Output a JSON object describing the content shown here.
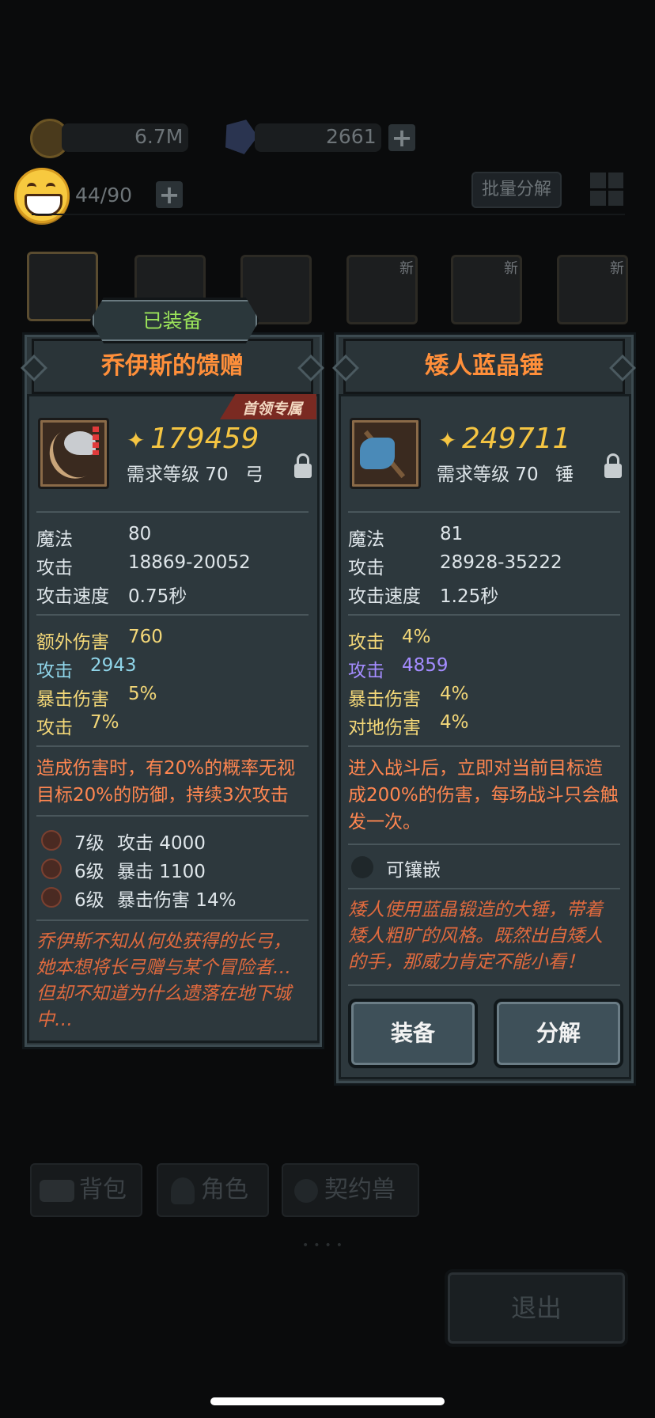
{
  "top": {
    "coins": "6.7M",
    "crystals": "2661",
    "bag_count": "44/90",
    "batch_label": "批量分解",
    "plus": "+"
  },
  "slots": [
    {
      "new": ""
    },
    {
      "new": ""
    },
    {
      "new": ""
    },
    {
      "new": "新"
    },
    {
      "new": "新"
    },
    {
      "new": "新"
    }
  ],
  "tabs": [
    "背包",
    "角色",
    "契约兽"
  ],
  "exit_label": "退出",
  "equipped_tag": "已装备",
  "left": {
    "title": "乔伊斯的馈赠",
    "badge": "首领专属",
    "power": "179459",
    "req": "需求等级 70",
    "type": "弓",
    "base": [
      {
        "label": "魔法",
        "value": "80"
      },
      {
        "label": "攻击",
        "value": "18869-20052"
      },
      {
        "label": "攻击速度",
        "value": "0.75秒"
      }
    ],
    "extra": [
      {
        "label": "额外伤害",
        "value": "760",
        "color": "#f3d778"
      },
      {
        "label": "攻击",
        "value": "2943",
        "color": "#8fd4e8"
      },
      {
        "label": "暴击伤害",
        "value": "5%",
        "color": "#f3d778"
      },
      {
        "label": "攻击",
        "value": "7%",
        "color": "#f3d778"
      }
    ],
    "skill": "造成伤害时，有20%的概率无视目标20%的防御，持续3次攻击",
    "gems": [
      {
        "level": "7级",
        "stat": "攻击 4000"
      },
      {
        "level": "6级",
        "stat": "暴击 1100"
      },
      {
        "level": "6级",
        "stat": "暴击伤害 14%"
      }
    ],
    "flavor": "乔伊斯不知从何处获得的长弓，她本想将长弓赠与某个冒险者…但却不知道为什么遗落在地下城中…"
  },
  "right": {
    "title": "矮人蓝晶锤",
    "power": "249711",
    "req": "需求等级 70",
    "type": "锤",
    "base": [
      {
        "label": "魔法",
        "value": "81"
      },
      {
        "label": "攻击",
        "value": "28928-35222"
      },
      {
        "label": "攻击速度",
        "value": "1.25秒"
      }
    ],
    "extra": [
      {
        "label": "攻击",
        "value": "4%",
        "color": "#f3d778"
      },
      {
        "label": "攻击",
        "value": "4859",
        "color": "#a48cff"
      },
      {
        "label": "暴击伤害",
        "value": "4%",
        "color": "#f3d778"
      },
      {
        "label": "对地伤害",
        "value": "4%",
        "color": "#f3d778"
      }
    ],
    "skill": "进入战斗后，立即对当前目标造成200%的伤害，每场战斗只会触发一次。",
    "socket": "可镶嵌",
    "flavor": "矮人使用蓝晶锻造的大锤，带着矮人粗旷的风格。既然出自矮人的手，那威力肯定不能小看！",
    "equip_label": "装备",
    "decompose_label": "分解"
  }
}
